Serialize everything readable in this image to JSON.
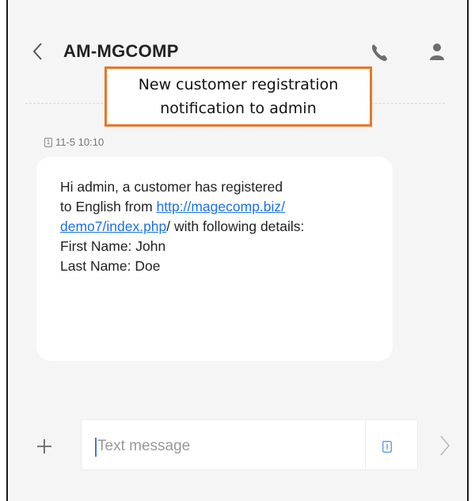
{
  "header": {
    "title": "AM-MGCOMP",
    "back_icon": "chevron-left-icon",
    "call_icon": "phone-icon",
    "contact_icon": "person-icon"
  },
  "callout": {
    "line1": "New customer registration",
    "line2": "notification to admin",
    "border_color": "#e87722"
  },
  "message": {
    "sim_label": "1",
    "timestamp": "11-5 10:10",
    "line1": "Hi admin, a customer has registered",
    "line2_prefix": "to English from ",
    "link_part1": "http://magecomp.biz/",
    "link_part2": "demo7/index.php",
    "line3_suffix": "/ with following details:",
    "line4": "First Name: John",
    "line5": "Last Name: Doe",
    "link_color": "#1a73e8"
  },
  "composer": {
    "placeholder": "Text message",
    "add_icon": "plus-icon",
    "sim_icon": "sim-icon",
    "sim_label": "1",
    "send_icon": "chevron-right-icon"
  }
}
